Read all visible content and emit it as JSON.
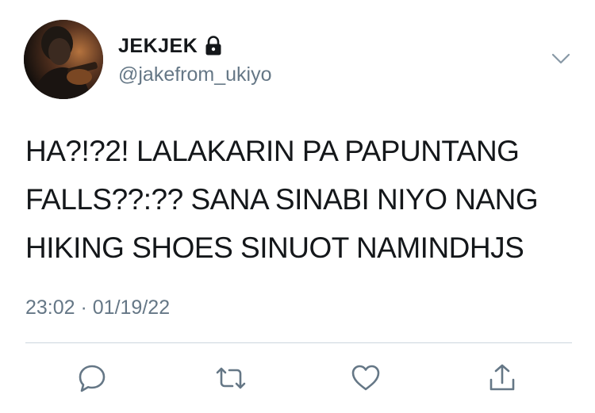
{
  "user": {
    "display_name": "JEKJEK",
    "handle": "@jakefrom_ukiyo",
    "avatar_icon": "profile-photo",
    "lock_icon": "lock-icon"
  },
  "tweet": {
    "text_lines": [
      "HA?!?2! LALAKARIN PA PAPUNTANG",
      "FALLS??:?? SANA SINABI NIYO NANG",
      "HIKING SHOES SINUOT NAMINDHJS"
    ],
    "timestamp": "23:02 · 01/19/22"
  },
  "actions": {
    "reply_icon": "reply-icon",
    "retweet_icon": "retweet-icon",
    "like_icon": "heart-icon",
    "share_icon": "share-icon",
    "menu_icon": "chevron-down-icon"
  },
  "colors": {
    "text": "#14171a",
    "secondary": "#657786",
    "divider": "#ccd6dd"
  }
}
